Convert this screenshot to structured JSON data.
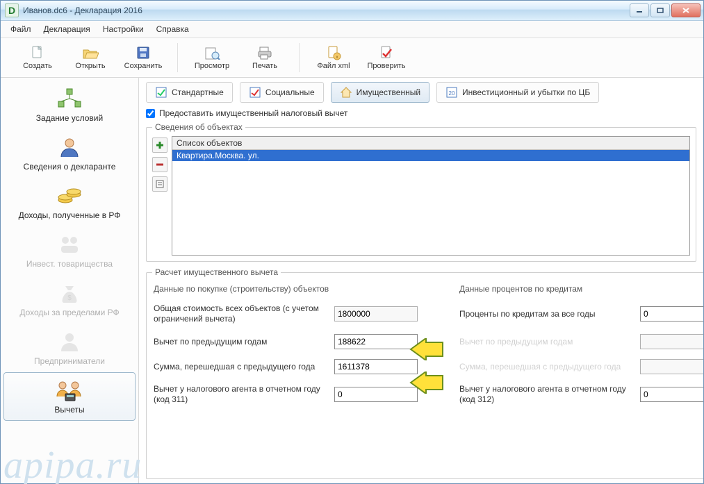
{
  "window": {
    "title": "Иванов.dc6 - Декларация 2016"
  },
  "menu": {
    "file": "Файл",
    "decl": "Декларация",
    "settings": "Настройки",
    "help": "Справка"
  },
  "toolbar": {
    "create": "Создать",
    "open": "Открыть",
    "save": "Сохранить",
    "preview": "Просмотр",
    "print": "Печать",
    "xml": "Файл xml",
    "check": "Проверить"
  },
  "nav": {
    "conditions": "Задание условий",
    "declarant": "Сведения о декларанте",
    "income_rf": "Доходы, полученные в РФ",
    "invest_partner": "Инвест. товарищества",
    "income_abroad": "Доходы за пределами РФ",
    "entrepreneur": "Предприниматели",
    "deductions": "Вычеты"
  },
  "tabs": {
    "standard": "Стандартные",
    "social": "Социальные",
    "property": "Имущественный",
    "invest": "Инвестиционный и убытки по ЦБ"
  },
  "provide_checkbox_label": "Предоставить имущественный налоговый вычет",
  "objects": {
    "legend": "Сведения об объектах",
    "header": "Список объектов",
    "row1": "Квартира.Москва. ул."
  },
  "calc": {
    "legend": "Расчет имущественного вычета",
    "head_purchase": "Данные по покупке (строительству) объектов",
    "head_loans": "Данные процентов по кредитам",
    "total_cost_label": "Общая стоимость всех объектов (с учетом ограничений вычета)",
    "total_cost_value": "1800000",
    "loan_interest_label": "Проценты по кредитам за все годы",
    "loan_interest_value": "0",
    "prev_years_deduction_label": "Вычет по предыдущим годам",
    "prev_years_deduction_value": "188622",
    "loan_prev_years_label": "Вычет по предыдущим годам",
    "loan_prev_years_value": "",
    "carried_over_label": "Сумма, перешедшая с предыдущего года",
    "carried_over_value": "1611378",
    "loan_carried_over_label": "Сумма, перешедшая с предыдущего года",
    "loan_carried_over_value": "",
    "agent_311_label": "Вычет у налогового агента в отчетном году (код 311)",
    "agent_311_value": "0",
    "agent_312_label": "Вычет у налогового агента в отчетном году (код 312)",
    "agent_312_value": "0"
  },
  "watermark": "apipa.ru"
}
